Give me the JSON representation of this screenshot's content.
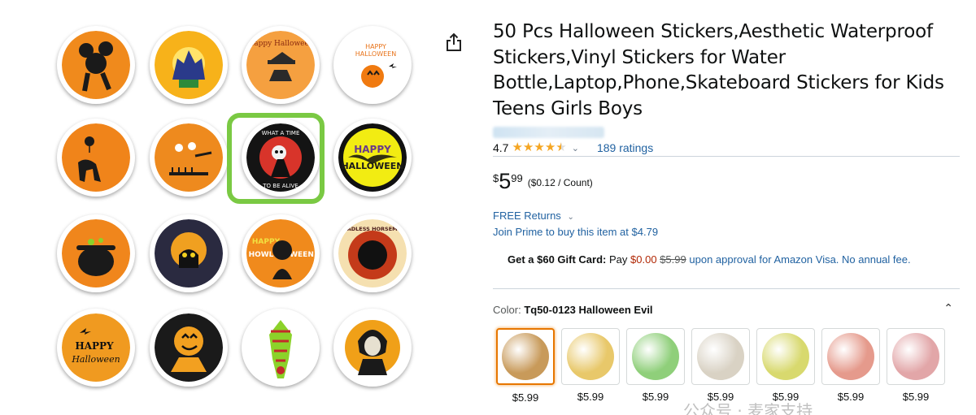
{
  "product": {
    "title": "50 Pcs Halloween Stickers,Aesthetic Waterproof Stickers,Vinyl Stickers for Water Bottle,Laptop,Phone,Skateboard Stickers for Kids Teens Girls Boys",
    "rating_value": "4.7",
    "rating_stars": 4.5,
    "ratings_count_label": "189 ratings"
  },
  "price": {
    "symbol": "$",
    "whole": "5",
    "fraction": "99",
    "unit_price": "($0.12 / Count)"
  },
  "returns_label": "FREE Returns",
  "prime_text": "Join Prime to buy this item at $4.79",
  "gift_card": {
    "bold": "Get a $60 Gift Card:",
    "pay": "Pay",
    "new_price": "$0.00",
    "old_price": "$5.99",
    "rest": "upon approval for Amazon Visa. No annual fee."
  },
  "color": {
    "label": "Color:",
    "value": "Tq50-0123 Halloween Evil"
  },
  "swatches": [
    {
      "price": "$5.99",
      "color": "#c89a5a",
      "selected": true
    },
    {
      "price": "$5.99",
      "color": "#e8c86a",
      "selected": false
    },
    {
      "price": "$5.99",
      "color": "#8fcf7a",
      "selected": false
    },
    {
      "price": "$5.99",
      "color": "#d9d2c4",
      "selected": false
    },
    {
      "price": "$5.99",
      "color": "#d8d96e",
      "selected": false
    },
    {
      "price": "$5.99",
      "color": "#e59a8c",
      "selected": false
    },
    {
      "price": "$5.99",
      "color": "#e2a6a8",
      "selected": false
    }
  ],
  "stickers": [
    {
      "name": "sticker-mickey",
      "bg": "#f08a1c",
      "fg": "#1a1a1a"
    },
    {
      "name": "sticker-haunted-house",
      "bg": "#f7b21a",
      "fg": "#2a3a8a"
    },
    {
      "name": "sticker-witch-hat",
      "bg": "#f5a040",
      "fg": "#2a2a2a"
    },
    {
      "name": "sticker-happy-halloween-pumpkin",
      "bg": "#ffffff",
      "fg": "#f07a10"
    },
    {
      "name": "sticker-spider-cat",
      "bg": "#f0841a",
      "fg": "#1a1a1a"
    },
    {
      "name": "sticker-pumpkin-witch",
      "bg": "#ee8a1e",
      "fg": "#1a1a1a"
    },
    {
      "name": "sticker-reaper",
      "bg": "#141414",
      "fg": "#d8342a"
    },
    {
      "name": "sticker-happy-halloween-bat",
      "bg": "#f2ec12",
      "fg": "#111111"
    },
    {
      "name": "sticker-cauldron",
      "bg": "#f0861c",
      "fg": "#1a1a1a"
    },
    {
      "name": "sticker-black-cat",
      "bg": "#2a2a40",
      "fg": "#f0a020"
    },
    {
      "name": "sticker-howl-cat",
      "bg": "#f08a1c",
      "fg": "#1a1a1a"
    },
    {
      "name": "sticker-headless-horseman",
      "bg": "#c43a1a",
      "fg": "#f5e0b0"
    },
    {
      "name": "sticker-happy-halloween-text",
      "bg": "#f09a20",
      "fg": "#1a1a1a"
    },
    {
      "name": "sticker-jack-o-lantern",
      "bg": "#1a1a1a",
      "fg": "#f2a020"
    },
    {
      "name": "sticker-skeleton-hand",
      "bg": "#c42a2a",
      "fg": "#8cd22a"
    },
    {
      "name": "sticker-ghoul",
      "bg": "#f0a018",
      "fg": "#1a1a1a"
    }
  ],
  "sticker_texts": {
    "s3": "Happy Halloween",
    "s4a": "HAPPY",
    "s4b": "HALLOWEEN",
    "s7a": "WHAT A TIME",
    "s7b": "TO BE ALIVE",
    "s8a": "HAPPY",
    "s8b": "HALLOWEEN",
    "s11a": "HAPPY",
    "s11b": "HOWL",
    "s11c": "WEEN",
    "s12": "HEADLESS HORSEMAN",
    "s13a": "HAPPY",
    "s13b": "Halloween"
  },
  "watermark": "公众号 · 麦家支持"
}
